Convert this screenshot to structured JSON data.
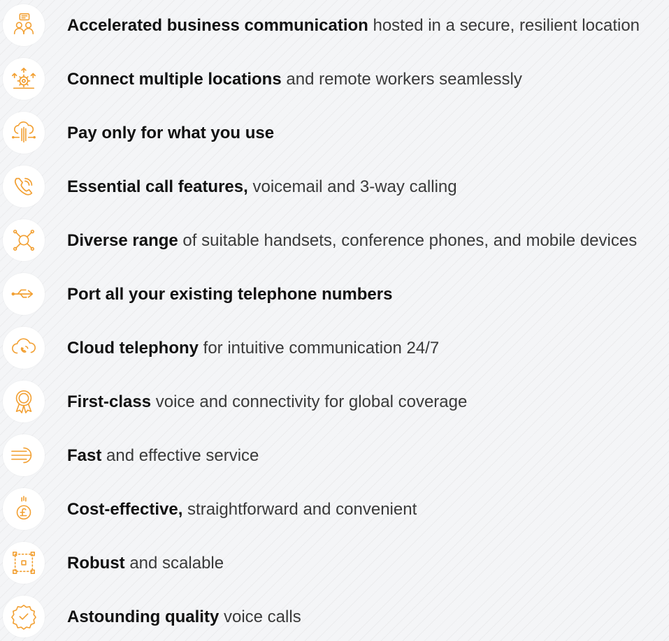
{
  "accent_color": "#f2a033",
  "items": [
    {
      "icon": "business-communication-icon",
      "bold": "Accelerated business communication",
      "rest": " hosted in a secure, resilient location"
    },
    {
      "icon": "connect-locations-icon",
      "bold": "Connect multiple locations",
      "rest": " and remote workers seamlessly"
    },
    {
      "icon": "cloud-usage-icon",
      "bold": "Pay only for what you use",
      "rest": ""
    },
    {
      "icon": "phone-call-icon",
      "bold": "Essential call features,",
      "rest": " voicemail and 3-way calling"
    },
    {
      "icon": "network-devices-icon",
      "bold": "Diverse range",
      "rest": " of suitable handsets, conference phones, and mobile devices"
    },
    {
      "icon": "port-arrows-icon",
      "bold": "Port all your existing telephone numbers",
      "rest": ""
    },
    {
      "icon": "cloud-phone-icon",
      "bold": "Cloud telephony",
      "rest": " for intuitive communication 24/7"
    },
    {
      "icon": "award-ribbon-icon",
      "bold": "First-class",
      "rest": " voice and connectivity for global coverage"
    },
    {
      "icon": "fast-wind-icon",
      "bold": "Fast",
      "rest": " and effective service"
    },
    {
      "icon": "pound-coin-icon",
      "bold": "Cost-effective,",
      "rest": " straightforward and convenient"
    },
    {
      "icon": "scalable-frame-icon",
      "bold": "Robust",
      "rest": " and scalable"
    },
    {
      "icon": "quality-badge-icon",
      "bold": "Astounding quality",
      "rest": " voice calls"
    }
  ]
}
